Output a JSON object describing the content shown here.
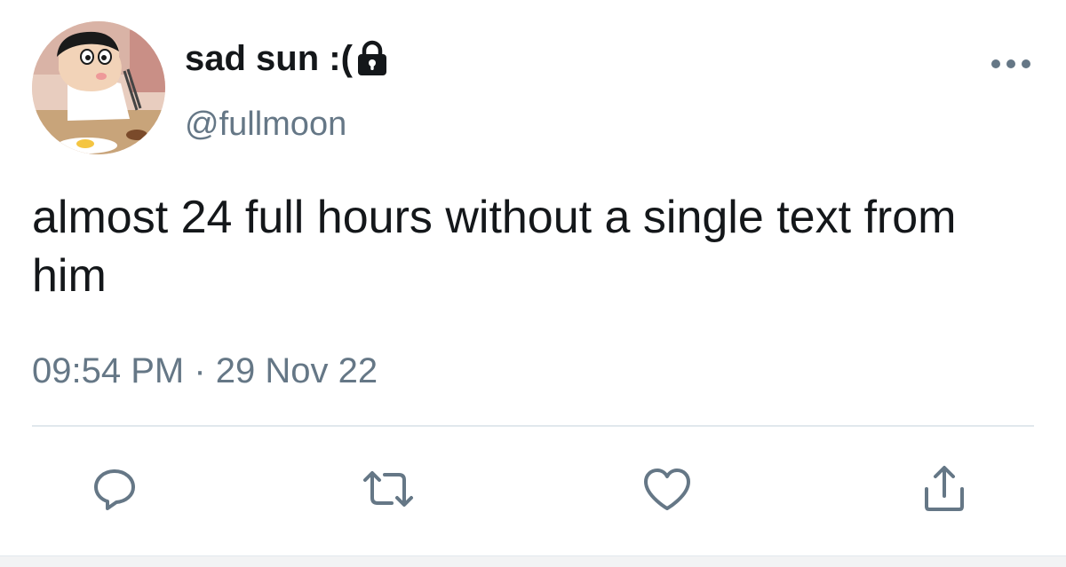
{
  "user": {
    "display_name": "sad sun :(",
    "handle": "@fullmoon",
    "protected": true,
    "avatar": "cartoon-boy-eating-avatar"
  },
  "tweet": {
    "text": "almost 24 full hours without a single text from him",
    "timestamp": "09:54 PM · 29 Nov 22"
  },
  "actions": {
    "icons": [
      "reply-icon",
      "retweet-icon",
      "like-icon",
      "share-icon"
    ]
  },
  "colors": {
    "text_primary": "#14171a",
    "text_secondary": "#657786",
    "icon": "#657786",
    "divider": "#e1e8ed"
  }
}
